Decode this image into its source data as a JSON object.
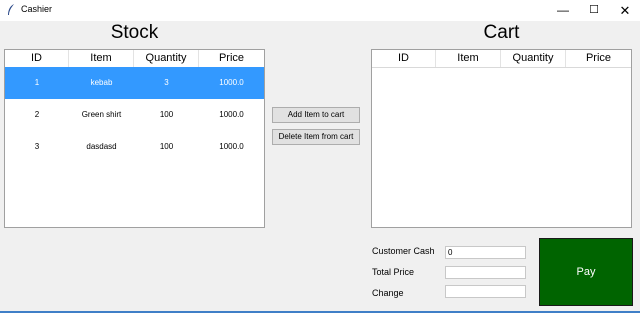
{
  "window": {
    "title": "Cashier",
    "controls": {
      "minimize": "—",
      "maximize": "☐",
      "close": "✕"
    }
  },
  "stock": {
    "title": "Stock",
    "columns": [
      "ID",
      "Item",
      "Quantity",
      "Price"
    ],
    "rows": [
      {
        "id": "1",
        "item": "kebab",
        "quantity": "3",
        "price": "1000.0",
        "selected": true
      },
      {
        "id": "2",
        "item": "Green shirt",
        "quantity": "100",
        "price": "1000.0",
        "selected": false
      },
      {
        "id": "3",
        "item": "dasdasd",
        "quantity": "100",
        "price": "1000.0",
        "selected": false
      }
    ]
  },
  "actions": {
    "add_label": "Add Item to cart",
    "delete_label": "Delete Item from cart"
  },
  "cart": {
    "title": "Cart",
    "columns": [
      "ID",
      "Item",
      "Quantity",
      "Price"
    ],
    "rows": []
  },
  "payment": {
    "customer_cash_label": "Customer Cash",
    "customer_cash_value": "0",
    "total_price_label": "Total Price",
    "total_price_value": "",
    "change_label": "Change",
    "change_value": "",
    "pay_label": "Pay"
  },
  "colors": {
    "selection": "#3399ff",
    "pay_button": "#006400"
  },
  "icons": {
    "app": "feather-icon"
  }
}
